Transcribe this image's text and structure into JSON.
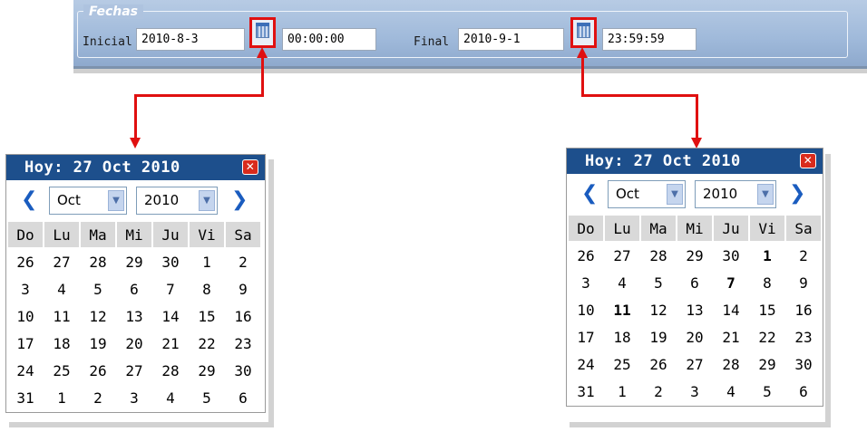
{
  "fechas": {
    "legend": "Fechas",
    "inicial_label": "Inicial",
    "inicial_date": "2010-8-3",
    "inicial_time": "00:00:00",
    "final_label": "Final",
    "final_date": "2010-9-1",
    "final_time": "23:59:59",
    "calendar_icon": "calendar-icon"
  },
  "calendar": {
    "title": "Hoy: 27 Oct 2010",
    "month": "Oct",
    "year": "2010",
    "prev": "❮",
    "next": "❯",
    "close": "✕",
    "weekdays": [
      "Do",
      "Lu",
      "Ma",
      "Mi",
      "Ju",
      "Vi",
      "Sa"
    ],
    "weeks": [
      [
        "26",
        "27",
        "28",
        "29",
        "30",
        "1",
        "2"
      ],
      [
        "3",
        "4",
        "5",
        "6",
        "7",
        "8",
        "9"
      ],
      [
        "10",
        "11",
        "12",
        "13",
        "14",
        "15",
        "16"
      ],
      [
        "17",
        "18",
        "19",
        "20",
        "21",
        "22",
        "23"
      ],
      [
        "24",
        "25",
        "26",
        "27",
        "28",
        "29",
        "30"
      ],
      [
        "31",
        "1",
        "2",
        "3",
        "4",
        "5",
        "6"
      ]
    ]
  },
  "colors": {
    "header_blue": "#1d4f8c",
    "weekend_red": "#e03b3b",
    "today_blue": "#2a7ad6",
    "arrow_red": "#e01010"
  }
}
